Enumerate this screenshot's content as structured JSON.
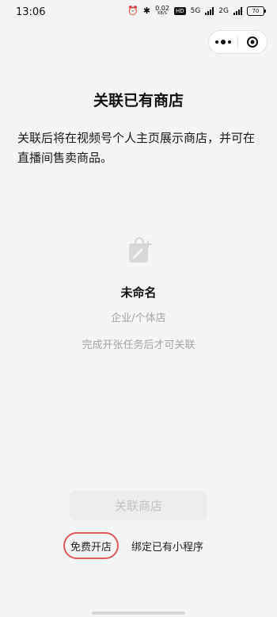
{
  "status_bar": {
    "time": "13:06",
    "net_speed": "0.02",
    "net_unit": "KB/S",
    "hd": "HD",
    "network": "5G",
    "network2": "2G",
    "battery": "70"
  },
  "page": {
    "title": "关联已有商店",
    "description": "关联后将在视频号个人主页展示商店，并可在直播间售卖商品。"
  },
  "store": {
    "name": "未命名",
    "type": "企业/个体店",
    "hint": "完成开张任务后才可关联"
  },
  "actions": {
    "link_store": "关联商店",
    "free_open": "免费开店",
    "bind_mini_program": "绑定已有小程序"
  },
  "colors": {
    "highlight_ring": "#e05a5a",
    "disabled_button_bg": "#ececec",
    "disabled_button_text": "#c3c3c3",
    "muted_text": "#a5a5a5"
  }
}
